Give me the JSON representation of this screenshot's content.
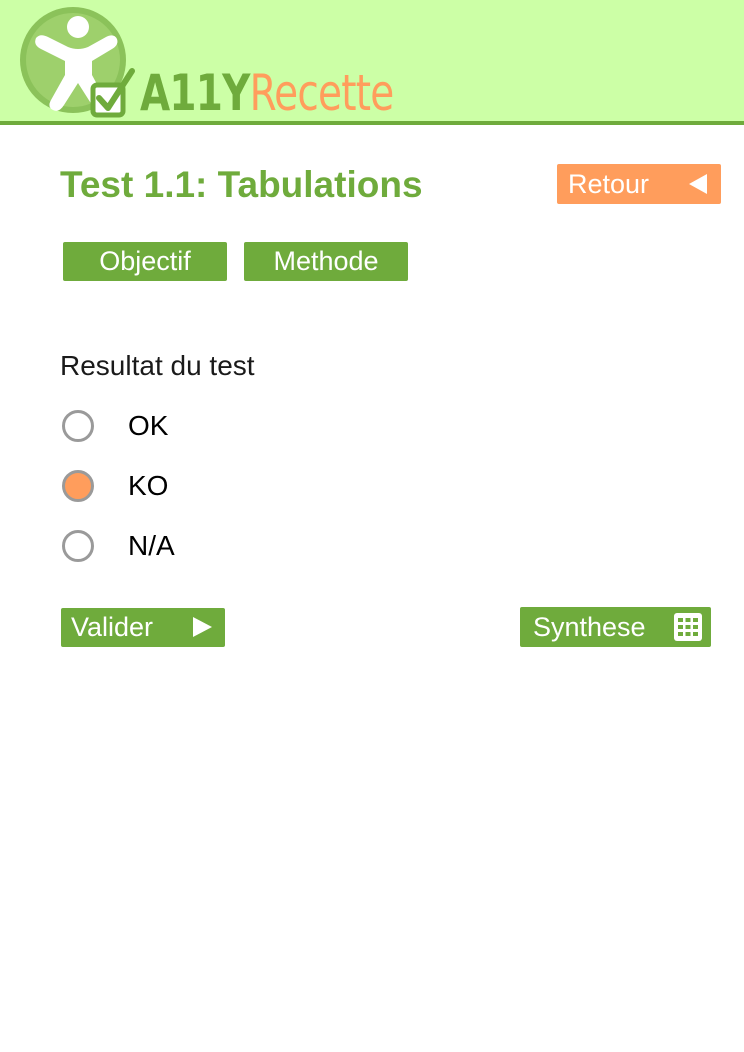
{
  "header": {
    "logo_part1": "A11Y",
    "logo_part2": "Recette"
  },
  "page": {
    "title": "Test 1.1: Tabulations"
  },
  "buttons": {
    "retour": "Retour",
    "objectif": "Objectif",
    "methode": "Methode",
    "valider": "Valider",
    "synthese": "Synthese"
  },
  "result": {
    "label": "Resultat du test",
    "options": [
      {
        "label": "OK",
        "checked": false
      },
      {
        "label": "KO",
        "checked": true
      },
      {
        "label": "N/A",
        "checked": false
      }
    ]
  },
  "icons": {
    "retour": "left-triangle-icon",
    "valider": "right-triangle-icon",
    "synthese": "table-grid-icon",
    "logo": "accessibility-person-icon",
    "logo_check": "checkbox-checked-icon"
  },
  "colors": {
    "header_bg": "#ccffa6",
    "green": "#6fab3c",
    "orange": "#ff9d5c"
  }
}
